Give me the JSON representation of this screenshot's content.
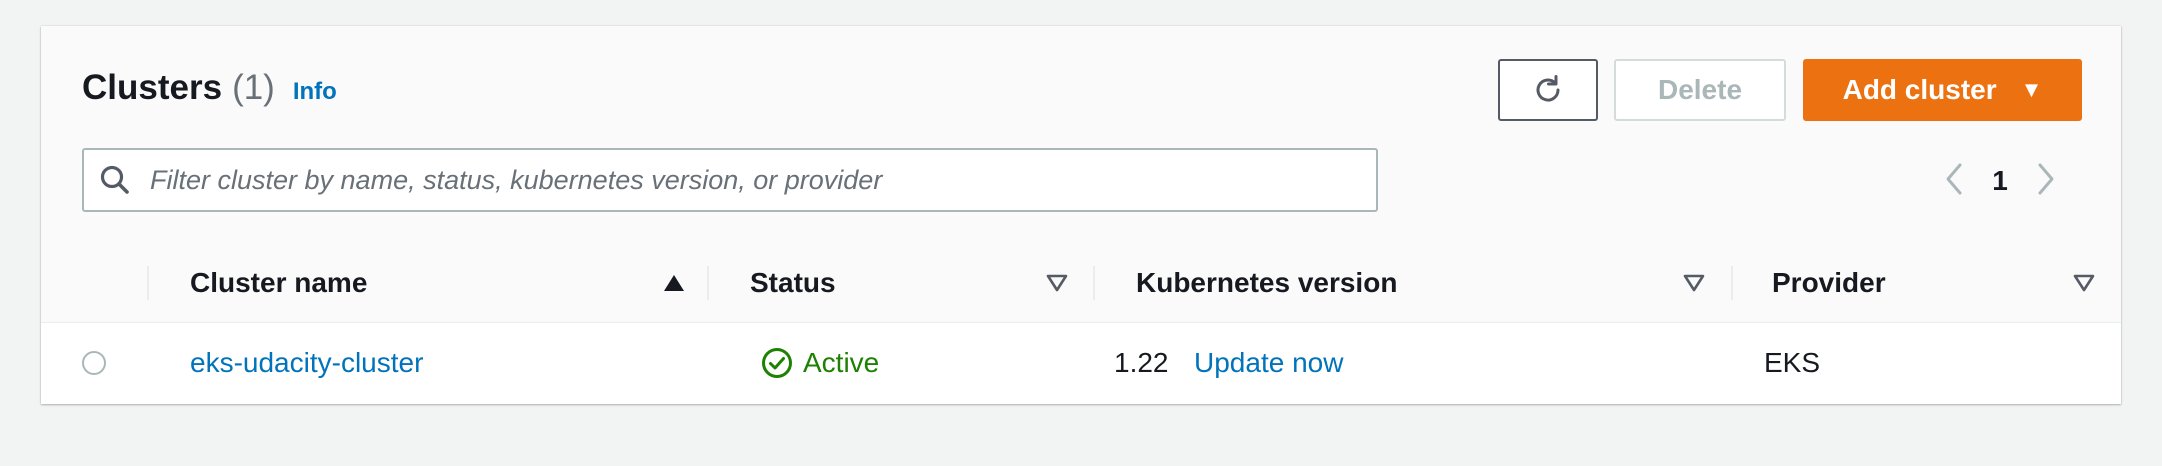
{
  "header": {
    "title": "Clusters",
    "count": "(1)",
    "info": "Info"
  },
  "toolbar": {
    "refresh_icon": "refresh-icon",
    "delete_label": "Delete",
    "add_label": "Add cluster",
    "add_caret": "▼"
  },
  "search": {
    "placeholder": "Filter cluster by name, status, kubernetes version, or provider",
    "value": ""
  },
  "pagination": {
    "current_page": "1"
  },
  "table": {
    "columns": [
      {
        "label": "Cluster name",
        "sort": "ascending"
      },
      {
        "label": "Status",
        "sort": "none"
      },
      {
        "label": "Kubernetes version",
        "sort": "none"
      },
      {
        "label": "Provider",
        "sort": "none"
      }
    ],
    "rows": [
      {
        "selected": false,
        "name": "eks-udacity-cluster",
        "status": "Active",
        "version": "1.22",
        "version_action": "Update now",
        "provider": "EKS"
      }
    ]
  },
  "colors": {
    "primary": "#ec7211",
    "link": "#0073bb",
    "success": "#1d8102",
    "disabled": "#aab7b8"
  }
}
